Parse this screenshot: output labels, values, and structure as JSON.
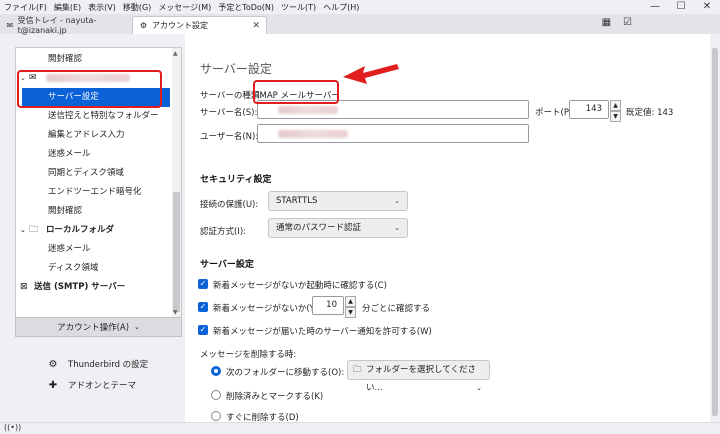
{
  "menubar": [
    "ファイル(F)",
    "編集(E)",
    "表示(V)",
    "移動(G)",
    "メッセージ(M)",
    "予定とToDo(N)",
    "ツール(T)",
    "ヘルプ(H)"
  ],
  "window_controls": [
    "—",
    "☐",
    "✕"
  ],
  "tabs": {
    "inbox": "受信トレイ - nayuta-t@izanaki.jp",
    "settings": "アカウント設定"
  },
  "sidebar": {
    "items": [
      "開封確認",
      "サーバー設定",
      "送信控えと特別なフォルダー",
      "編集とアドレス入力",
      "迷惑メール",
      "同期とディスク領域",
      "エンドツーエンド暗号化",
      "開封確認",
      "ローカルフォルダ",
      "迷惑メール",
      "ディスク領域",
      "送信 (SMTP) サーバー"
    ],
    "account_actions": "アカウント操作(A)",
    "thunderbird_settings": "Thunderbird の設定",
    "addons": "アドオンとテーマ"
  },
  "main": {
    "title": "サーバー設定",
    "server_type_label": "サーバーの種類:",
    "server_type_value": "IMAP メールサーバー",
    "server_name_label": "サーバー名(S):",
    "port_label": "ポート(P):",
    "port_value": "143",
    "default_label": "既定値: 143",
    "user_name_label": "ユーザー名(N):",
    "security_heading": "セキュリティ設定",
    "connection_label": "接続の保護(U):",
    "connection_value": "STARTTLS",
    "auth_label": "認証方式(I):",
    "auth_value": "通常のパスワード認証",
    "server_heading": "サーバー設定",
    "check_startup": "新着メッセージがないか起動時に確認する(C)",
    "check_every_pre": "新着メッセージがないか(Y)",
    "check_every_value": "10",
    "check_every_post": "分ごとに確認する",
    "allow_notify": "新着メッセージが届いた時のサーバー通知を許可する(W)",
    "on_delete_label": "メッセージを削除する時:",
    "delete_move": "次のフォルダーに移動する(O):",
    "folder_select": "フォルダーを選択してください...",
    "delete_mark": "削除済みとマークする(K)",
    "delete_now": "すぐに削除する(D)"
  },
  "colors": {
    "accent": "#0a62d6",
    "highlight_box": "#e01e1e"
  }
}
